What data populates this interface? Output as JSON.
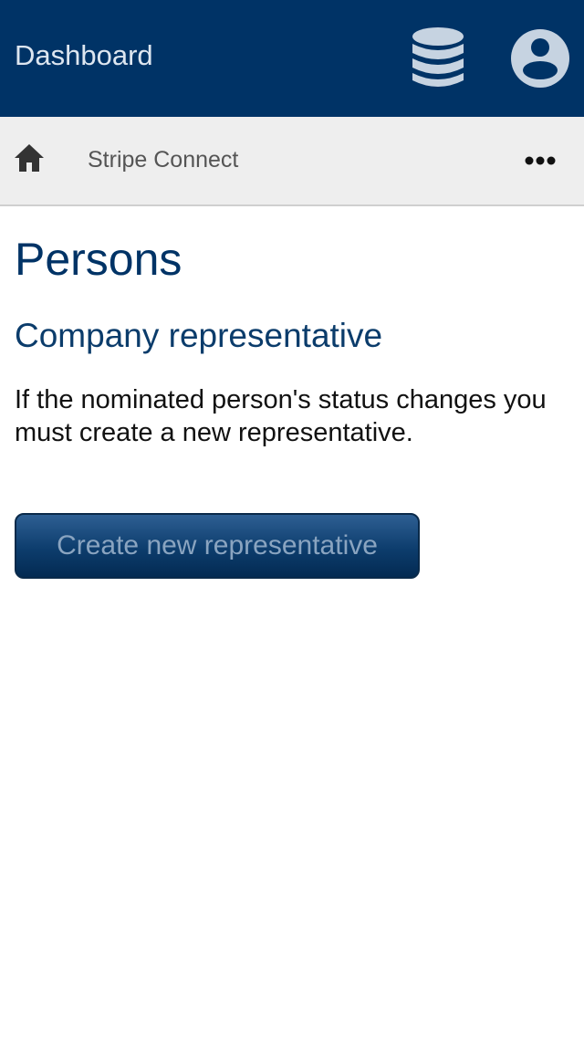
{
  "header": {
    "title": "Dashboard",
    "icons": {
      "database": "database-icon",
      "account": "user-circle-icon"
    },
    "icon_color": "#c6d3e1",
    "background": "#003366"
  },
  "nav": {
    "home_icon": "home-icon",
    "breadcrumb": "Stripe Connect",
    "more_icon": "more-horizontal-icon"
  },
  "main": {
    "page_title": "Persons",
    "section_title": "Company representative",
    "description": "If the nominated person's status changes you must create a new representative.",
    "create_button_label": "Create new representative"
  }
}
